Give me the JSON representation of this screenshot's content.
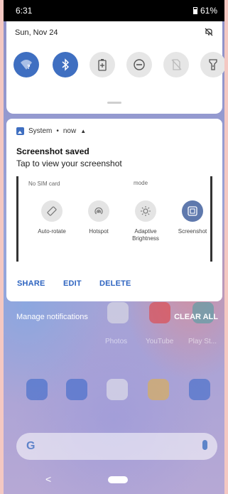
{
  "status_bar": {
    "time": "6:31",
    "battery": "61%"
  },
  "quick_settings": {
    "date": "Sun, Nov 24",
    "tiles": [
      {
        "icon": "wifi-icon",
        "state": "on"
      },
      {
        "icon": "bluetooth-icon",
        "state": "on"
      },
      {
        "icon": "battery-saver-icon",
        "state": "off"
      },
      {
        "icon": "do-not-disturb-icon",
        "state": "off"
      },
      {
        "icon": "no-sim-icon",
        "state": "off"
      },
      {
        "icon": "flashlight-icon",
        "state": "off"
      }
    ]
  },
  "notification": {
    "app_name": "System",
    "time": "now",
    "title": "Screenshot saved",
    "text": "Tap to view your screenshot",
    "preview": {
      "no_sim": "No SIM card",
      "mode": "mode",
      "tiles": [
        {
          "label": "Auto-rotate",
          "icon": "auto-rotate-icon",
          "state": "off"
        },
        {
          "label": "Hotspot",
          "icon": "hotspot-icon",
          "state": "off"
        },
        {
          "label": "Adaptive Brightness",
          "icon": "brightness-icon",
          "state": "off"
        },
        {
          "label": "Screenshot",
          "icon": "screenshot-icon",
          "state": "on"
        }
      ]
    },
    "actions": {
      "share": "SHARE",
      "edit": "EDIT",
      "delete": "DELETE"
    }
  },
  "manage_notifications": "Manage notifications",
  "clear_all": "CLEAR ALL",
  "home_screen": {
    "app_labels": [
      "Photos",
      "YouTube",
      "Play St..."
    ]
  },
  "colors": {
    "accent": "#3f6fc1",
    "action_text": "#2e64c0"
  }
}
